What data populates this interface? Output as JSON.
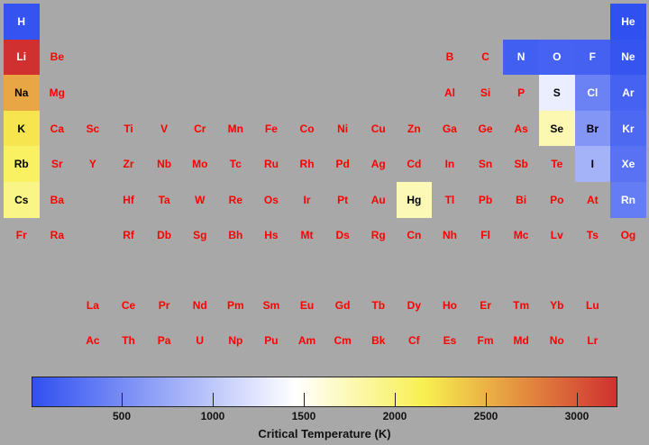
{
  "chart_data": {
    "type": "heatmap",
    "layout": "periodic-table",
    "colorbar": {
      "label": "Critical Temperature (K)",
      "ticks": [
        500,
        1000,
        1500,
        2000,
        2500,
        3000
      ],
      "range": [
        5,
        3223
      ],
      "colors": [
        "#3050f0",
        "#ffffff",
        "#f8f050",
        "#d03030"
      ],
      "color_stops": [
        0.0,
        0.45,
        0.67,
        1.0
      ]
    },
    "nodata_color": "#ff0000",
    "elements": [
      {
        "symbol": "H",
        "row": 1,
        "col": 1,
        "value": 33
      },
      {
        "symbol": "He",
        "row": 1,
        "col": 18,
        "value": 5
      },
      {
        "symbol": "Li",
        "row": 2,
        "col": 1,
        "value": 3223
      },
      {
        "symbol": "Be",
        "row": 2,
        "col": 2,
        "value": null
      },
      {
        "symbol": "B",
        "row": 2,
        "col": 13,
        "value": null
      },
      {
        "symbol": "C",
        "row": 2,
        "col": 14,
        "value": null
      },
      {
        "symbol": "N",
        "row": 2,
        "col": 15,
        "value": 126
      },
      {
        "symbol": "O",
        "row": 2,
        "col": 16,
        "value": 155
      },
      {
        "symbol": "F",
        "row": 2,
        "col": 17,
        "value": 144
      },
      {
        "symbol": "Ne",
        "row": 2,
        "col": 18,
        "value": 44
      },
      {
        "symbol": "Na",
        "row": 3,
        "col": 1,
        "value": 2573
      },
      {
        "symbol": "Mg",
        "row": 3,
        "col": 2,
        "value": null
      },
      {
        "symbol": "Al",
        "row": 3,
        "col": 13,
        "value": null
      },
      {
        "symbol": "Si",
        "row": 3,
        "col": 14,
        "value": null
      },
      {
        "symbol": "P",
        "row": 3,
        "col": 15,
        "value": null
      },
      {
        "symbol": "S",
        "row": 3,
        "col": 16,
        "value": 1314
      },
      {
        "symbol": "Cl",
        "row": 3,
        "col": 17,
        "value": 417
      },
      {
        "symbol": "Ar",
        "row": 3,
        "col": 18,
        "value": 151
      },
      {
        "symbol": "K",
        "row": 4,
        "col": 1,
        "value": 2223
      },
      {
        "symbol": "Ca",
        "row": 4,
        "col": 2,
        "value": null
      },
      {
        "symbol": "Sc",
        "row": 4,
        "col": 3,
        "value": null
      },
      {
        "symbol": "Ti",
        "row": 4,
        "col": 4,
        "value": null
      },
      {
        "symbol": "V",
        "row": 4,
        "col": 5,
        "value": null
      },
      {
        "symbol": "Cr",
        "row": 4,
        "col": 6,
        "value": null
      },
      {
        "symbol": "Mn",
        "row": 4,
        "col": 7,
        "value": null
      },
      {
        "symbol": "Fe",
        "row": 4,
        "col": 8,
        "value": null
      },
      {
        "symbol": "Co",
        "row": 4,
        "col": 9,
        "value": null
      },
      {
        "symbol": "Ni",
        "row": 4,
        "col": 10,
        "value": null
      },
      {
        "symbol": "Cu",
        "row": 4,
        "col": 11,
        "value": null
      },
      {
        "symbol": "Zn",
        "row": 4,
        "col": 12,
        "value": null
      },
      {
        "symbol": "Ga",
        "row": 4,
        "col": 13,
        "value": null
      },
      {
        "symbol": "Ge",
        "row": 4,
        "col": 14,
        "value": null
      },
      {
        "symbol": "As",
        "row": 4,
        "col": 15,
        "value": null
      },
      {
        "symbol": "Se",
        "row": 4,
        "col": 16,
        "value": 1766
      },
      {
        "symbol": "Br",
        "row": 4,
        "col": 17,
        "value": 588
      },
      {
        "symbol": "Kr",
        "row": 4,
        "col": 18,
        "value": 209
      },
      {
        "symbol": "Rb",
        "row": 5,
        "col": 1,
        "value": 2093
      },
      {
        "symbol": "Sr",
        "row": 5,
        "col": 2,
        "value": null
      },
      {
        "symbol": "Y",
        "row": 5,
        "col": 3,
        "value": null
      },
      {
        "symbol": "Zr",
        "row": 5,
        "col": 4,
        "value": null
      },
      {
        "symbol": "Nb",
        "row": 5,
        "col": 5,
        "value": null
      },
      {
        "symbol": "Mo",
        "row": 5,
        "col": 6,
        "value": null
      },
      {
        "symbol": "Tc",
        "row": 5,
        "col": 7,
        "value": null
      },
      {
        "symbol": "Ru",
        "row": 5,
        "col": 8,
        "value": null
      },
      {
        "symbol": "Rh",
        "row": 5,
        "col": 9,
        "value": null
      },
      {
        "symbol": "Pd",
        "row": 5,
        "col": 10,
        "value": null
      },
      {
        "symbol": "Ag",
        "row": 5,
        "col": 11,
        "value": null
      },
      {
        "symbol": "Cd",
        "row": 5,
        "col": 12,
        "value": null
      },
      {
        "symbol": "In",
        "row": 5,
        "col": 13,
        "value": null
      },
      {
        "symbol": "Sn",
        "row": 5,
        "col": 14,
        "value": null
      },
      {
        "symbol": "Sb",
        "row": 5,
        "col": 15,
        "value": null
      },
      {
        "symbol": "Te",
        "row": 5,
        "col": 16,
        "value": null
      },
      {
        "symbol": "I",
        "row": 5,
        "col": 17,
        "value": 819
      },
      {
        "symbol": "Xe",
        "row": 5,
        "col": 18,
        "value": 290
      },
      {
        "symbol": "Cs",
        "row": 6,
        "col": 1,
        "value": 1938
      },
      {
        "symbol": "Ba",
        "row": 6,
        "col": 2,
        "value": null
      },
      {
        "symbol": "Hf",
        "row": 6,
        "col": 4,
        "value": null
      },
      {
        "symbol": "Ta",
        "row": 6,
        "col": 5,
        "value": null
      },
      {
        "symbol": "W",
        "row": 6,
        "col": 6,
        "value": null
      },
      {
        "symbol": "Re",
        "row": 6,
        "col": 7,
        "value": null
      },
      {
        "symbol": "Os",
        "row": 6,
        "col": 8,
        "value": null
      },
      {
        "symbol": "Ir",
        "row": 6,
        "col": 9,
        "value": null
      },
      {
        "symbol": "Pt",
        "row": 6,
        "col": 10,
        "value": null
      },
      {
        "symbol": "Au",
        "row": 6,
        "col": 11,
        "value": null
      },
      {
        "symbol": "Hg",
        "row": 6,
        "col": 12,
        "value": 1750
      },
      {
        "symbol": "Tl",
        "row": 6,
        "col": 13,
        "value": null
      },
      {
        "symbol": "Pb",
        "row": 6,
        "col": 14,
        "value": null
      },
      {
        "symbol": "Bi",
        "row": 6,
        "col": 15,
        "value": null
      },
      {
        "symbol": "Po",
        "row": 6,
        "col": 16,
        "value": null
      },
      {
        "symbol": "At",
        "row": 6,
        "col": 17,
        "value": null
      },
      {
        "symbol": "Rn",
        "row": 6,
        "col": 18,
        "value": 377
      },
      {
        "symbol": "Fr",
        "row": 7,
        "col": 1,
        "value": null
      },
      {
        "symbol": "Ra",
        "row": 7,
        "col": 2,
        "value": null
      },
      {
        "symbol": "Rf",
        "row": 7,
        "col": 4,
        "value": null
      },
      {
        "symbol": "Db",
        "row": 7,
        "col": 5,
        "value": null
      },
      {
        "symbol": "Sg",
        "row": 7,
        "col": 6,
        "value": null
      },
      {
        "symbol": "Bh",
        "row": 7,
        "col": 7,
        "value": null
      },
      {
        "symbol": "Hs",
        "row": 7,
        "col": 8,
        "value": null
      },
      {
        "symbol": "Mt",
        "row": 7,
        "col": 9,
        "value": null
      },
      {
        "symbol": "Ds",
        "row": 7,
        "col": 10,
        "value": null
      },
      {
        "symbol": "Rg",
        "row": 7,
        "col": 11,
        "value": null
      },
      {
        "symbol": "Cn",
        "row": 7,
        "col": 12,
        "value": null
      },
      {
        "symbol": "Nh",
        "row": 7,
        "col": 13,
        "value": null
      },
      {
        "symbol": "Fl",
        "row": 7,
        "col": 14,
        "value": null
      },
      {
        "symbol": "Mc",
        "row": 7,
        "col": 15,
        "value": null
      },
      {
        "symbol": "Lv",
        "row": 7,
        "col": 16,
        "value": null
      },
      {
        "symbol": "Ts",
        "row": 7,
        "col": 17,
        "value": null
      },
      {
        "symbol": "Og",
        "row": 7,
        "col": 18,
        "value": null
      },
      {
        "symbol": "La",
        "row": 9,
        "col": 3,
        "value": null
      },
      {
        "symbol": "Ce",
        "row": 9,
        "col": 4,
        "value": null
      },
      {
        "symbol": "Pr",
        "row": 9,
        "col": 5,
        "value": null
      },
      {
        "symbol": "Nd",
        "row": 9,
        "col": 6,
        "value": null
      },
      {
        "symbol": "Pm",
        "row": 9,
        "col": 7,
        "value": null
      },
      {
        "symbol": "Sm",
        "row": 9,
        "col": 8,
        "value": null
      },
      {
        "symbol": "Eu",
        "row": 9,
        "col": 9,
        "value": null
      },
      {
        "symbol": "Gd",
        "row": 9,
        "col": 10,
        "value": null
      },
      {
        "symbol": "Tb",
        "row": 9,
        "col": 11,
        "value": null
      },
      {
        "symbol": "Dy",
        "row": 9,
        "col": 12,
        "value": null
      },
      {
        "symbol": "Ho",
        "row": 9,
        "col": 13,
        "value": null
      },
      {
        "symbol": "Er",
        "row": 9,
        "col": 14,
        "value": null
      },
      {
        "symbol": "Tm",
        "row": 9,
        "col": 15,
        "value": null
      },
      {
        "symbol": "Yb",
        "row": 9,
        "col": 16,
        "value": null
      },
      {
        "symbol": "Lu",
        "row": 9,
        "col": 17,
        "value": null
      },
      {
        "symbol": "Ac",
        "row": 10,
        "col": 3,
        "value": null
      },
      {
        "symbol": "Th",
        "row": 10,
        "col": 4,
        "value": null
      },
      {
        "symbol": "Pa",
        "row": 10,
        "col": 5,
        "value": null
      },
      {
        "symbol": "U",
        "row": 10,
        "col": 6,
        "value": null
      },
      {
        "symbol": "Np",
        "row": 10,
        "col": 7,
        "value": null
      },
      {
        "symbol": "Pu",
        "row": 10,
        "col": 8,
        "value": null
      },
      {
        "symbol": "Am",
        "row": 10,
        "col": 9,
        "value": null
      },
      {
        "symbol": "Cm",
        "row": 10,
        "col": 10,
        "value": null
      },
      {
        "symbol": "Bk",
        "row": 10,
        "col": 11,
        "value": null
      },
      {
        "symbol": "Cf",
        "row": 10,
        "col": 12,
        "value": null
      },
      {
        "symbol": "Es",
        "row": 10,
        "col": 13,
        "value": null
      },
      {
        "symbol": "Fm",
        "row": 10,
        "col": 14,
        "value": null
      },
      {
        "symbol": "Md",
        "row": 10,
        "col": 15,
        "value": null
      },
      {
        "symbol": "No",
        "row": 10,
        "col": 16,
        "value": null
      },
      {
        "symbol": "Lr",
        "row": 10,
        "col": 17,
        "value": null
      }
    ]
  }
}
